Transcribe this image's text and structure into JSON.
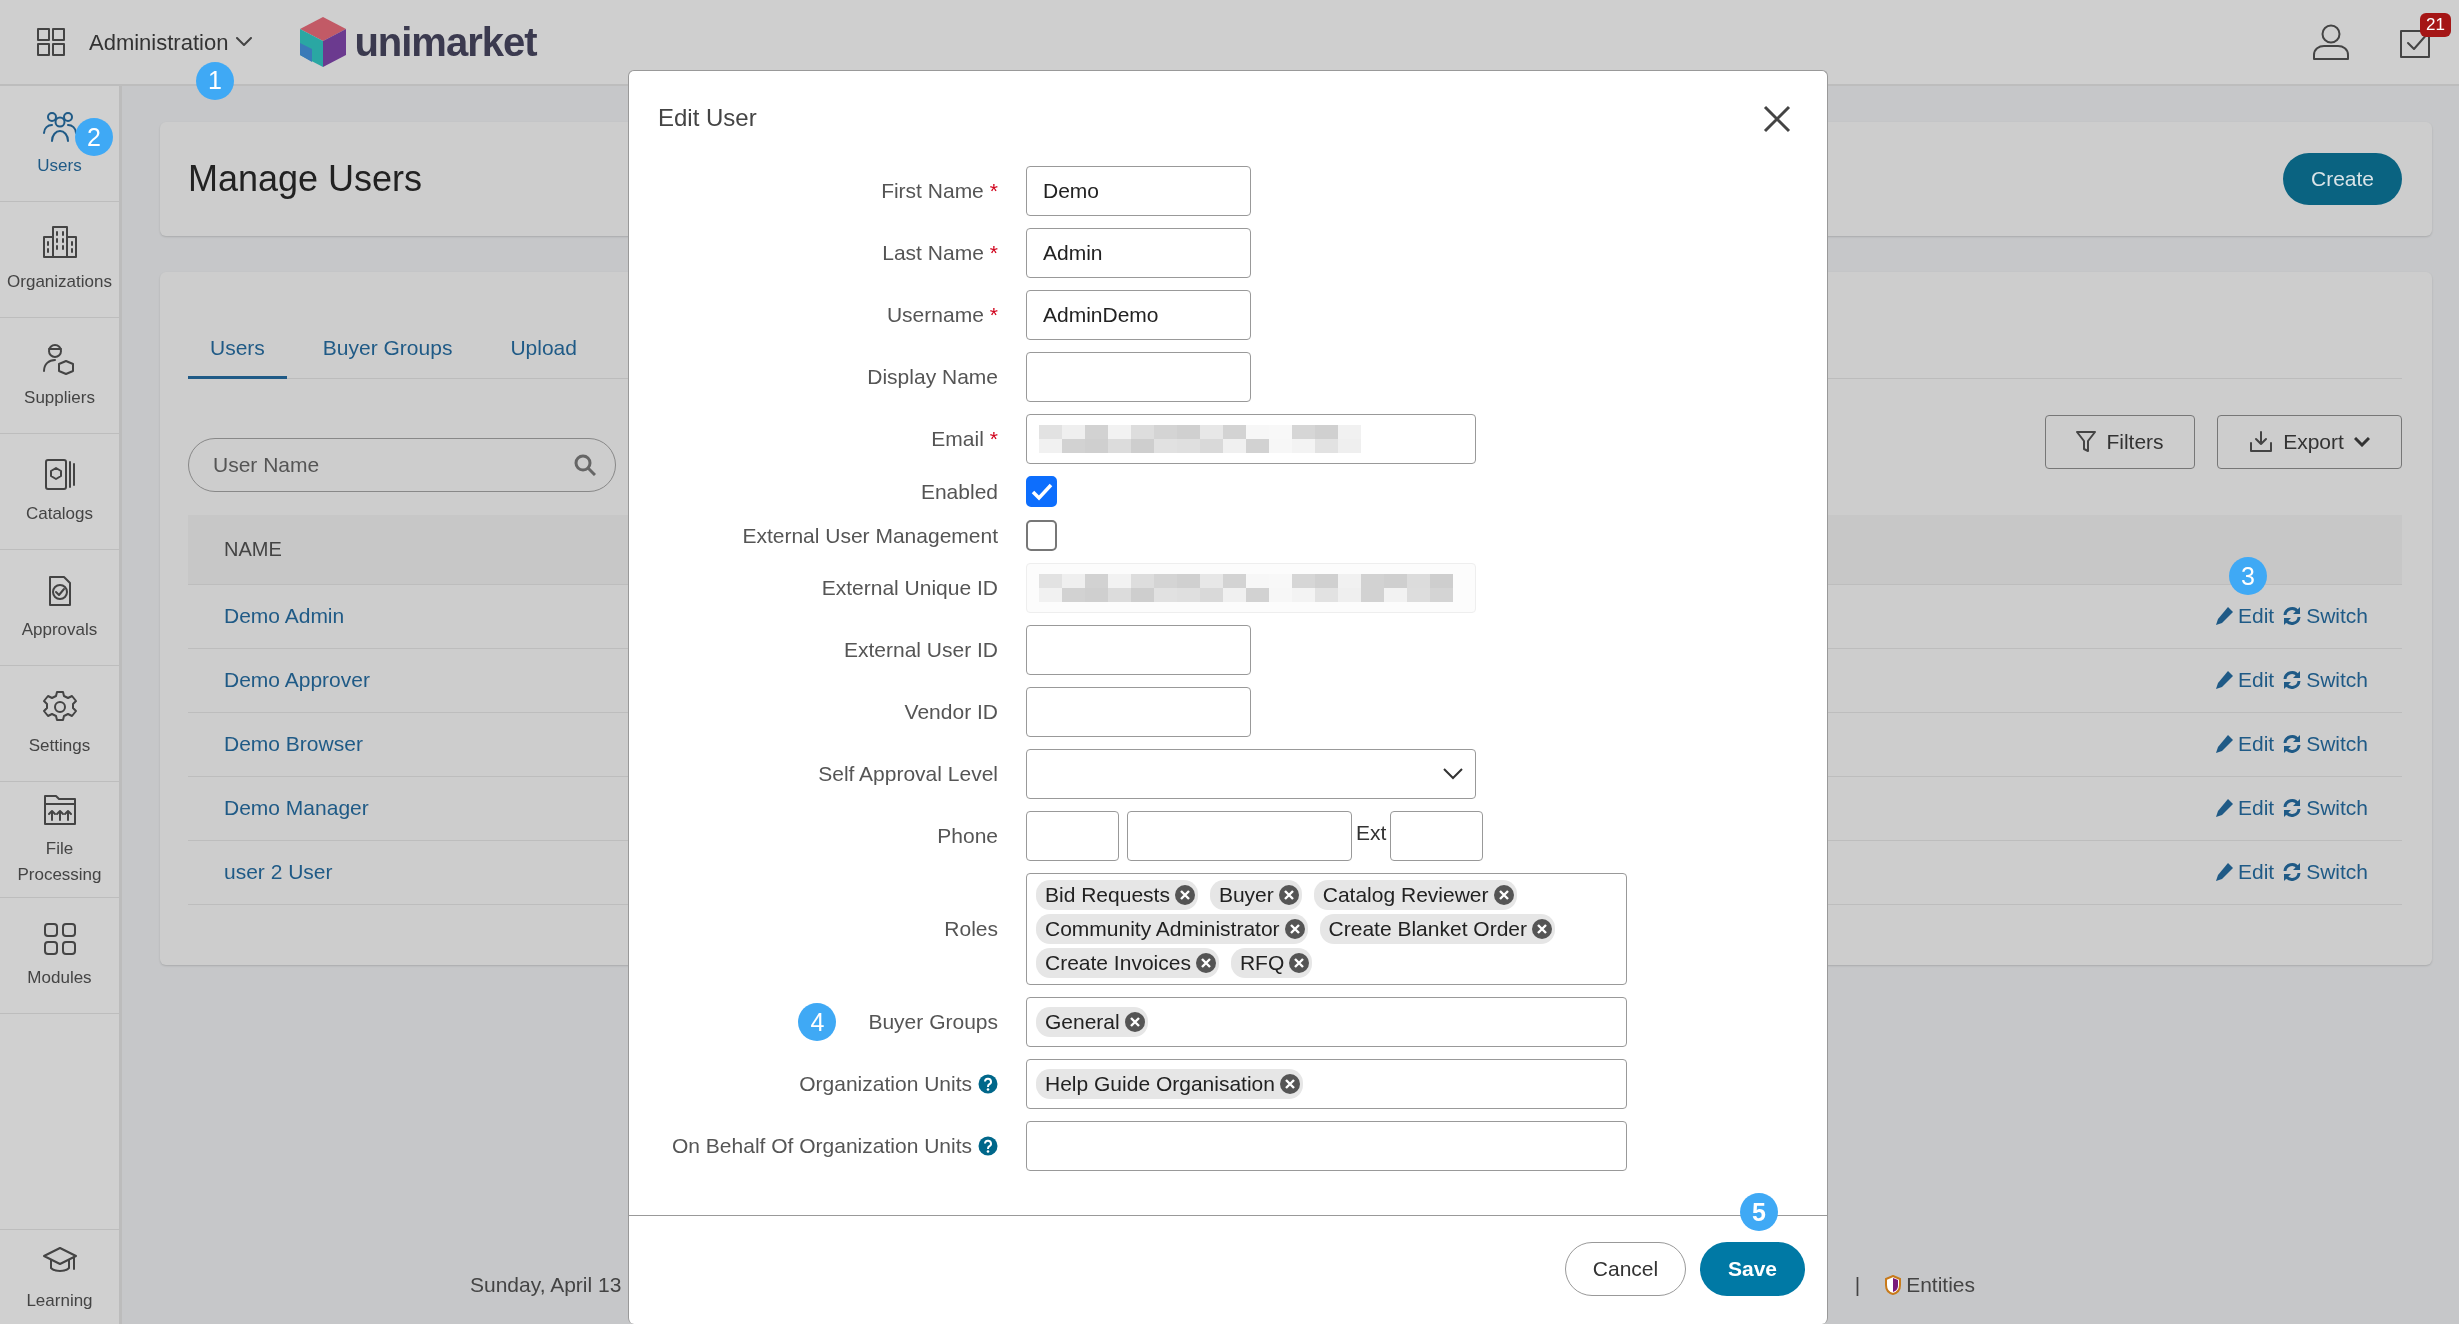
{
  "header": {
    "app_menu": {
      "label": "Administration",
      "marker": "1"
    },
    "logo": "unimarket",
    "tasks_badge": "21"
  },
  "sidebar": {
    "items": [
      {
        "label": "Users",
        "selected": true,
        "marker": "2"
      },
      {
        "label": "Organizations",
        "selected": false
      },
      {
        "label": "Suppliers",
        "selected": false
      },
      {
        "label": "Catalogs",
        "selected": false
      },
      {
        "label": "Approvals",
        "selected": false
      },
      {
        "label": "Settings",
        "selected": false
      },
      {
        "label": "File Processing",
        "selected": false
      },
      {
        "label": "Modules",
        "selected": false
      }
    ],
    "bottom_item": {
      "label": "Learning"
    }
  },
  "page": {
    "title": "Manage Users",
    "create_button": "Create",
    "tabs": [
      {
        "label": "Users",
        "selected": true
      },
      {
        "label": "Buyer Groups",
        "selected": false
      },
      {
        "label": "Upload",
        "selected": false
      }
    ],
    "search": {
      "placeholder": "User Name"
    },
    "filters_button": "Filters",
    "export_button": "Export",
    "table": {
      "columns": [
        "NAME"
      ],
      "rows": [
        {
          "name": "Demo Admin",
          "edit": "Edit",
          "switch": "Switch",
          "marker": "3"
        },
        {
          "name": "Demo Approver",
          "edit": "Edit",
          "switch": "Switch"
        },
        {
          "name": "Demo Browser",
          "edit": "Edit",
          "switch": "Switch"
        },
        {
          "name": "Demo Manager",
          "edit": "Edit",
          "switch": "Switch"
        },
        {
          "name": "user 2 User",
          "edit": "Edit",
          "switch": "Switch"
        }
      ]
    }
  },
  "footer": {
    "date": "Sunday, April 13",
    "separator": "|",
    "entities": "Entities"
  },
  "dialog": {
    "title": "Edit User",
    "fields": [
      {
        "kind": "text",
        "label": "First Name",
        "required": true,
        "required_mark": "*",
        "help": false,
        "value": "Demo"
      },
      {
        "kind": "text",
        "label": "Last Name",
        "required": true,
        "required_mark": "*",
        "help": false,
        "value": "Admin"
      },
      {
        "kind": "text",
        "label": "Username",
        "required": true,
        "required_mark": "*",
        "help": false,
        "value": "AdminDemo"
      },
      {
        "kind": "text",
        "label": "Display Name",
        "required": false,
        "help": false
      },
      {
        "kind": "redacted",
        "label": "Email",
        "required": true,
        "required_mark": "*",
        "help": false,
        "disabled": false
      },
      {
        "kind": "checkbox",
        "label": "Enabled",
        "required": false,
        "help": false,
        "checked": true
      },
      {
        "kind": "checkbox",
        "label": "External User Management",
        "required": false,
        "help": false,
        "checked": false
      },
      {
        "kind": "redacted",
        "label": "External Unique ID",
        "required": false,
        "help": false,
        "disabled": true
      },
      {
        "kind": "text",
        "label": "External User ID",
        "required": false,
        "help": false
      },
      {
        "kind": "text",
        "label": "Vendor ID",
        "required": false,
        "help": false
      },
      {
        "kind": "select",
        "label": "Self Approval Level",
        "required": false,
        "help": false
      },
      {
        "kind": "phone",
        "label": "Phone",
        "required": false,
        "help": false,
        "ext_label": "Ext"
      },
      {
        "kind": "tags",
        "label": "Roles",
        "required": false,
        "help": false,
        "tags": [
          "Bid Requests",
          "Buyer",
          "Catalog Reviewer",
          "Community Administrator",
          "Create Blanket Order",
          "Create Invoices",
          "RFQ"
        ]
      },
      {
        "kind": "tags",
        "label": "Buyer Groups",
        "required": false,
        "help": false,
        "marker": "4",
        "tags": [
          "General"
        ]
      },
      {
        "kind": "tags",
        "label": "Organization Units",
        "required": false,
        "help": true,
        "tags": [
          "Help Guide Organisation"
        ]
      },
      {
        "kind": "tags",
        "label": "On Behalf Of Organization Units",
        "required": false,
        "help": true
      }
    ],
    "cancel_button": "Cancel",
    "save_button": {
      "label": "Save",
      "marker": "5"
    }
  }
}
